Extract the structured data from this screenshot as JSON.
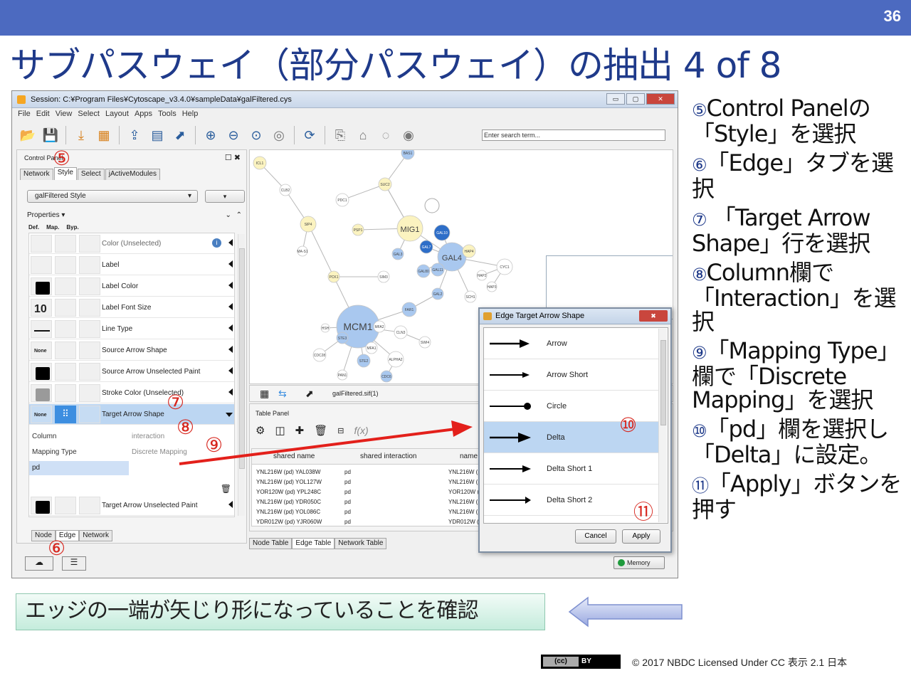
{
  "slide": {
    "number": "36",
    "title": "サブパスウェイ（部分パスウェイ）の抽出 4 of 8"
  },
  "window": {
    "title": "Session: C:¥Program Files¥Cytoscape_v3.4.0¥sampleData¥galFiltered.cys",
    "controls": [
      "▭",
      "▢",
      "✕"
    ]
  },
  "menu": [
    "File",
    "Edit",
    "View",
    "Select",
    "Layout",
    "Apps",
    "Tools",
    "Help"
  ],
  "search": {
    "placeholder": "Enter search term..."
  },
  "control_panel": {
    "title": "Control Panel",
    "tabs": [
      "Network",
      "Style",
      "Select",
      "jActiveModules"
    ],
    "active_tab": "Style",
    "style_name": "galFiltered Style",
    "properties_label": "Properties",
    "col_headers": [
      "Def.",
      "Map.",
      "Byp."
    ],
    "rows": [
      {
        "name": "Color (Unselected)"
      },
      {
        "name": "Label"
      },
      {
        "name": "Label Color"
      },
      {
        "name": "Label Font Size",
        "value": "10"
      },
      {
        "name": "Line Type"
      },
      {
        "name": "Source Arrow Shape",
        "value": "None"
      },
      {
        "name": "Source Arrow Unselected Paint"
      },
      {
        "name": "Stroke Color (Unselected)"
      },
      {
        "name": "Target Arrow Shape",
        "value": "None"
      },
      {
        "name": "Target Arrow Unselected Paint"
      }
    ],
    "mapping": {
      "column_label": "Column",
      "column_value": "interaction",
      "type_label": "Mapping Type",
      "type_value": "Discrete Mapping",
      "key": "pd"
    },
    "bottom_tabs": [
      "Node",
      "Edge",
      "Network"
    ],
    "active_bottom_tab": "Edge"
  },
  "network": {
    "file": "galFiltered.sif(1)",
    "nodes": [
      {
        "label": "MCM1"
      },
      {
        "label": "GAL4"
      },
      {
        "label": "MIG1"
      },
      {
        "label": "CYC1"
      },
      {
        "label": "ALPHA2"
      },
      {
        "label": "SIP4"
      },
      {
        "label": "FAR1"
      },
      {
        "label": "STE2"
      },
      {
        "label": "MFA1"
      },
      {
        "label": "HAP4"
      },
      {
        "label": "GAL11"
      },
      {
        "label": "GAL80"
      },
      {
        "label": "GAL3"
      },
      {
        "label": "GAL2"
      },
      {
        "label": "GAL10"
      },
      {
        "label": "GAL7"
      },
      {
        "label": "PDC1"
      },
      {
        "label": "SUC2"
      },
      {
        "label": "BAS1"
      },
      {
        "label": "ICL1"
      },
      {
        "label": "CLB2"
      },
      {
        "label": "CDC28"
      },
      {
        "label": "CLN3"
      },
      {
        "label": "SWI4"
      },
      {
        "label": "MFA2"
      },
      {
        "label": "STE3"
      },
      {
        "label": "PAN1"
      },
      {
        "label": "PCK1"
      },
      {
        "label": "SIM3"
      },
      {
        "label": "HAP2"
      },
      {
        "label": "HAP3"
      },
      {
        "label": "SCH1"
      },
      {
        "label": "PSP1"
      },
      {
        "label": "MA-S1"
      },
      {
        "label": "HSH"
      },
      {
        "label": "CDC6"
      }
    ]
  },
  "table_panel": {
    "title": "Table Panel",
    "columns": [
      "shared name",
      "shared interaction",
      "name"
    ],
    "rows": [
      [
        "YNL216W (pd) YAL038W",
        "pd",
        "YNL216W (p"
      ],
      [
        "YNL216W (pd) YOL127W",
        "pd",
        "YNL216W (p"
      ],
      [
        "YOR120W (pd) YPL248C",
        "pd",
        "YOR120W (p"
      ],
      [
        "YNL216W (pd) YDR050C",
        "pd",
        "YNL216W (p"
      ],
      [
        "YNL216W (pd) YOL086C",
        "pd",
        "YNL216W (p"
      ],
      [
        "YDR012W (pd) YJR060W",
        "pd",
        "YDR012W (p"
      ]
    ],
    "fx": "f(x)",
    "bottom_tabs": [
      "Node Table",
      "Edge Table",
      "Network Table"
    ],
    "active_bottom_tab": "Edge Table",
    "memory": "Memory"
  },
  "dialog": {
    "title": "Edge Target Arrow Shape",
    "items": [
      "Arrow",
      "Arrow Short",
      "Circle",
      "Delta",
      "Delta Short 1",
      "Delta Short 2"
    ],
    "selected": "Delta",
    "cancel": "Cancel",
    "apply": "Apply"
  },
  "annotations": [
    "⑤",
    "⑥",
    "⑦",
    "⑧",
    "⑨",
    "⑩",
    "⑪"
  ],
  "steps": [
    {
      "num": "⑤",
      "text": "Control Panelの「Style」を選択"
    },
    {
      "num": "⑥",
      "text": "「Edge」タブを選択"
    },
    {
      "num": "⑦",
      "text": " 「Target Arrow Shape」行を選択"
    },
    {
      "num": "⑧",
      "text": "Column欄で「Interaction」を選択"
    },
    {
      "num": "⑨",
      "text": "「Mapping Type」欄で「Discrete Mapping」を選択"
    },
    {
      "num": "⑩",
      "text": "「pd」欄を選択し「Delta」に設定。"
    },
    {
      "num": "⑪",
      "text": "「Apply」ボタンを押す"
    }
  ],
  "note": "エッジの一端が矢じり形になっていることを確認",
  "footer": {
    "badge_left": "(cc)",
    "badge_right": "BY",
    "text": "© 2017  NBDC Licensed Under CC 表示 2.1 日本"
  },
  "colors": {
    "topbar": "#4c6ac0",
    "title": "#1f3a8a",
    "annotation": "#d7261e",
    "selection": "#bcd6f2"
  }
}
